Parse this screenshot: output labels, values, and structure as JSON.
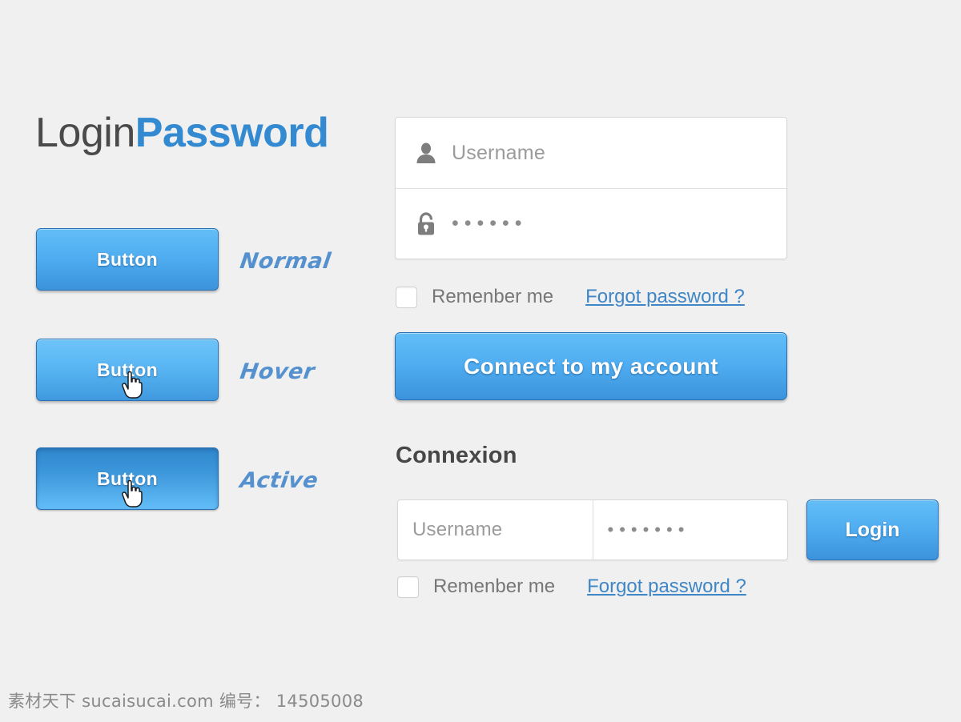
{
  "brand": {
    "first": "Login",
    "second": "Password",
    "accent_color": "#338ad1",
    "dark_color": "#4a4a4a"
  },
  "button_states": [
    {
      "button_label": "Button",
      "state_label": "Normal",
      "icon": "none"
    },
    {
      "button_label": "Button",
      "state_label": "Hover",
      "icon": "hand-cursor"
    },
    {
      "button_label": "Button",
      "state_label": "Active",
      "icon": "hand-cursor"
    }
  ],
  "login_form": {
    "username": {
      "icon": "user-icon",
      "placeholder": "Username",
      "value": ""
    },
    "password": {
      "icon": "lock-icon",
      "placeholder": "",
      "value": "••••••",
      "dot_count": 6
    },
    "remember_label": "Remenber me",
    "remember_checked": false,
    "forgot_label": "Forgot password ?",
    "submit_label": "Connect to my account"
  },
  "connexion": {
    "heading": "Connexion",
    "username": {
      "placeholder": "Username",
      "value": ""
    },
    "password": {
      "value": "•••••••",
      "dot_count": 7
    },
    "login_label": "Login",
    "remember_label": "Remenber me",
    "remember_checked": false,
    "forgot_label": "Forgot password ?"
  },
  "watermark": {
    "text": "素材天下 sucaisucai.com  编号： 14505008"
  }
}
